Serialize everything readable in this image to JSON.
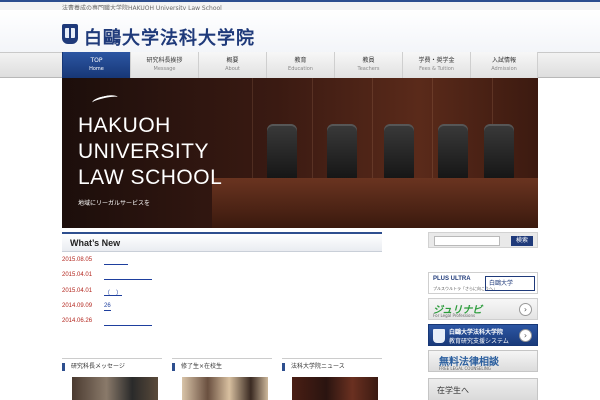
{
  "topbar": {
    "tagline": "法曹養成の専門職大学院HAKUOH University Law School"
  },
  "header": {
    "logo_title": "白鷗大学法科大学院"
  },
  "nav": {
    "items": [
      {
        "jp": "TOP",
        "en": "Home",
        "active": true
      },
      {
        "jp": "研究科長挨拶",
        "en": "Message",
        "active": false
      },
      {
        "jp": "概要",
        "en": "About",
        "active": false
      },
      {
        "jp": "教育",
        "en": "Education",
        "active": false
      },
      {
        "jp": "教員",
        "en": "Teachers",
        "active": false
      },
      {
        "jp": "学費・奨学金",
        "en": "Fees & Tuition",
        "active": false
      },
      {
        "jp": "入試情報",
        "en": "Admission",
        "active": false
      }
    ]
  },
  "hero": {
    "line1": "HAKUOH",
    "line2": "UNIVERSITY",
    "line3": "LAW SCHOOL",
    "caption": "地域にリーガルサービスを"
  },
  "news": {
    "title": "What’s New",
    "items": [
      {
        "date": "2015.08.05",
        "text": "　　　　"
      },
      {
        "date": "2015.04.01",
        "text": "　　　　　　　　"
      },
      {
        "date": "2015.04.01",
        "text": "（　）"
      },
      {
        "date": "2014.09.09",
        "text": "26"
      },
      {
        "date": "2014.06.26",
        "text": "　　　　　　　　"
      }
    ]
  },
  "cards": [
    {
      "head": "研究科長メッセージ"
    },
    {
      "head": "修了生×在校生"
    },
    {
      "head": "法科大学院ニュース"
    }
  ],
  "search": {
    "placeholder": "",
    "button": "検索"
  },
  "banners": {
    "plus_ultra": "PLUS ULTRA",
    "plus_ultra_sub": "プルスウルトラ「さらに向こうへ」",
    "plus_ultra_logo": "白鷗大学",
    "juri_navi": "ジュリナビ",
    "juri_navi_sub": "For Legal Professions",
    "edu_title": "白鷗大学法科大学院",
    "edu_sub": "教育研究支援システム",
    "consult_title": "無料法律相談",
    "consult_sub": "FREE LEGAL COUNSELING",
    "students": "在学生へ"
  }
}
